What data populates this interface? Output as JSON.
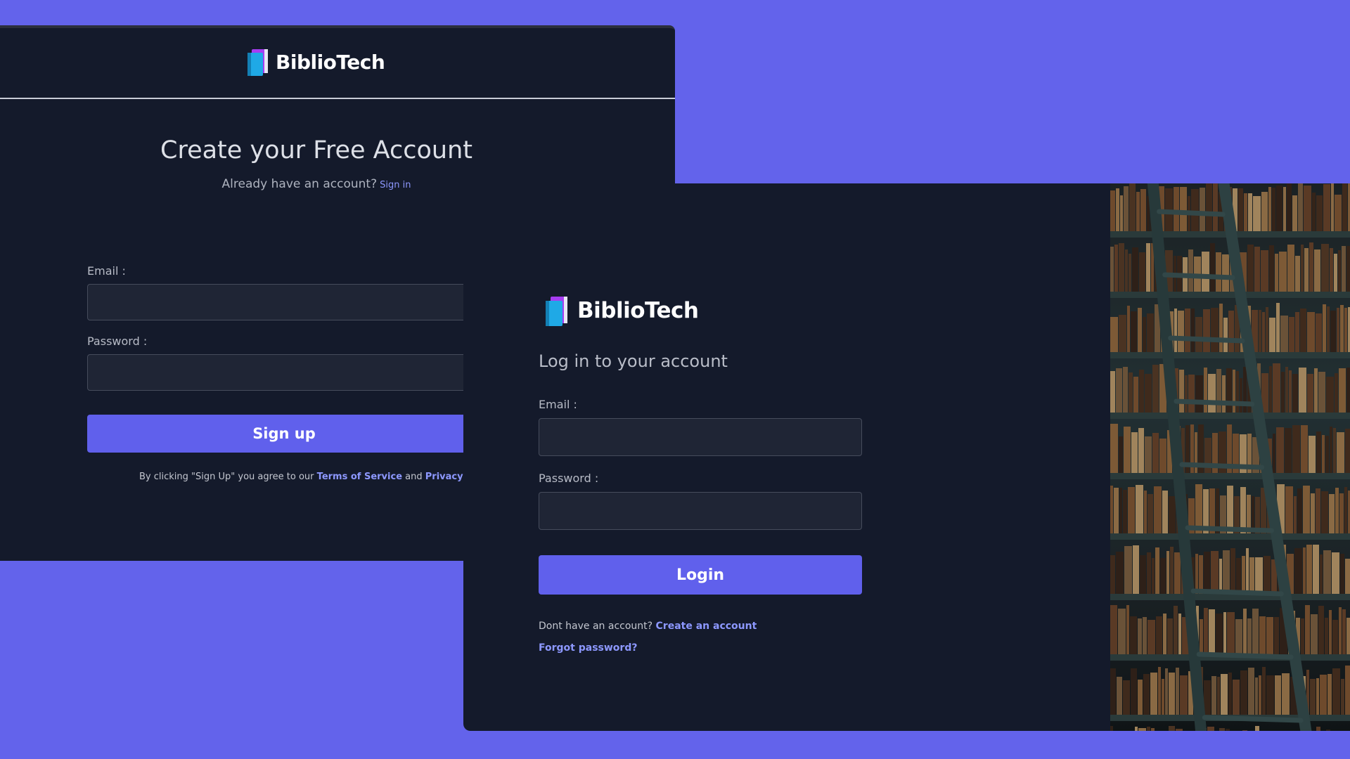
{
  "brand": {
    "name": "BiblioTech",
    "icon": "book-icon"
  },
  "signup": {
    "title": "Create your Free Account",
    "already_text": "Already have an account?",
    "signin_link": "Sign in",
    "email_label": "Email :",
    "email_value": "",
    "password_label": "Password :",
    "password_value": "",
    "submit_label": "Sign up",
    "terms_prefix": "By clicking \"Sign Up\" you agree to our",
    "terms_link": "Terms of Service",
    "terms_and": "and",
    "privacy_link": "Privacy"
  },
  "login": {
    "title": "Log in to your account",
    "email_label": "Email :",
    "email_value": "",
    "password_label": "Password :",
    "password_value": "",
    "submit_label": "Login",
    "no_account_text": "Dont have an account?",
    "create_link": "Create an account",
    "forgot_link": "Forgot password?"
  },
  "colors": {
    "background": "#6363eb",
    "panel": "#141a2b",
    "primary_button": "#6060ec",
    "link": "#8d98ff",
    "input_bg": "#1f2535"
  }
}
